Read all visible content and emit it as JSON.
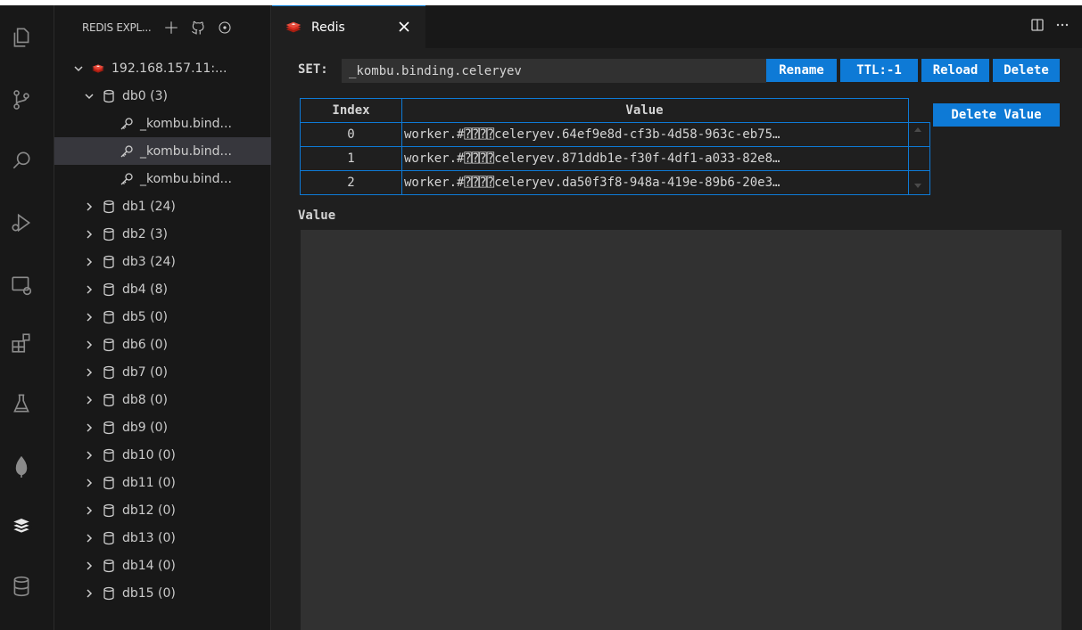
{
  "sidebar": {
    "title": "REDIS EXPL...",
    "tree": [
      {
        "label": "192.168.157.11:...",
        "icon": "redis-icon",
        "expanded": true
      },
      {
        "label": "db0 (3)",
        "icon": "database-icon",
        "expanded": true
      },
      {
        "label": "_kombu.bind...",
        "icon": "key-icon"
      },
      {
        "label": "_kombu.bind...",
        "icon": "key-icon",
        "selected": true
      },
      {
        "label": "_kombu.bind...",
        "icon": "key-icon"
      },
      {
        "label": "db1 (24)",
        "icon": "database-icon"
      },
      {
        "label": "db2 (3)",
        "icon": "database-icon"
      },
      {
        "label": "db3 (24)",
        "icon": "database-icon"
      },
      {
        "label": "db4 (8)",
        "icon": "database-icon"
      },
      {
        "label": "db5 (0)",
        "icon": "database-icon"
      },
      {
        "label": "db6 (0)",
        "icon": "database-icon"
      },
      {
        "label": "db7 (0)",
        "icon": "database-icon"
      },
      {
        "label": "db8 (0)",
        "icon": "database-icon"
      },
      {
        "label": "db9 (0)",
        "icon": "database-icon"
      },
      {
        "label": "db10 (0)",
        "icon": "database-icon"
      },
      {
        "label": "db11 (0)",
        "icon": "database-icon"
      },
      {
        "label": "db12 (0)",
        "icon": "database-icon"
      },
      {
        "label": "db13 (0)",
        "icon": "database-icon"
      },
      {
        "label": "db14 (0)",
        "icon": "database-icon"
      },
      {
        "label": "db15 (0)",
        "icon": "database-icon"
      }
    ]
  },
  "tab": {
    "label": "Redis"
  },
  "editor": {
    "type_label": "SET:",
    "key_value": "_kombu.binding.celeryev",
    "buttons": {
      "rename": "Rename",
      "ttl": "TTL:-1",
      "reload": "Reload",
      "delete": "Delete",
      "delete_value": "Delete Value"
    },
    "table": {
      "headers": [
        "Index",
        "Value"
      ],
      "rows": [
        {
          "index": "0",
          "value": "worker.#⍰⍰⍰⍰celeryev.64ef9e8d-cf3b-4d58-963c-eb75…"
        },
        {
          "index": "1",
          "value": "worker.#⍰⍰⍰⍰celeryev.871ddb1e-f30f-4df1-a033-82e8…"
        },
        {
          "index": "2",
          "value": "worker.#⍰⍰⍰⍰celeryev.da50f3f8-948a-419e-89b6-20e3…"
        }
      ]
    },
    "value_label": "Value"
  },
  "colors": {
    "accent": "#0e7ad6",
    "background": "#1f1f1f",
    "sidebar": "#181818",
    "input": "#313131"
  }
}
